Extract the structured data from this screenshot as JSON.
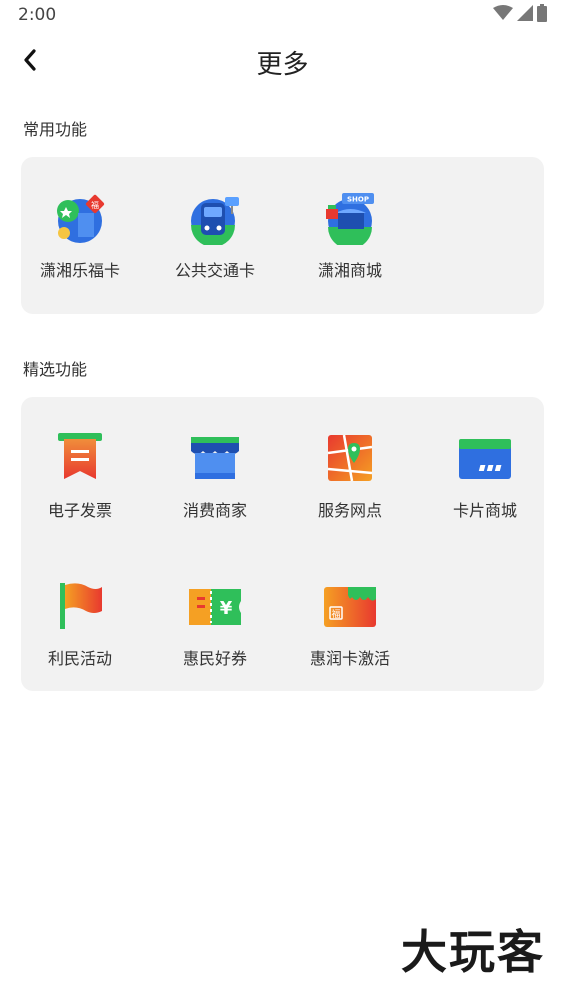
{
  "status_bar": {
    "time": "2:00",
    "icons": [
      "wifi-icon",
      "signal-icon",
      "battery-icon"
    ]
  },
  "header": {
    "title": "更多",
    "back_icon": "back-arrow-icon"
  },
  "common_section": {
    "title": "常用功能",
    "items": [
      {
        "label": "潇湘乐福卡",
        "icon": "lefu-card-icon"
      },
      {
        "label": "公共交通卡",
        "icon": "transit-card-icon"
      },
      {
        "label": "潇湘商城",
        "icon": "shop-icon"
      }
    ]
  },
  "featured_section": {
    "title": "精选功能",
    "items": [
      {
        "label": "电子发票",
        "icon": "invoice-icon"
      },
      {
        "label": "消费商家",
        "icon": "merchant-store-icon"
      },
      {
        "label": "服务网点",
        "icon": "map-location-icon"
      },
      {
        "label": "卡片商城",
        "icon": "card-mall-icon"
      },
      {
        "label": "利民活动",
        "icon": "flag-icon"
      },
      {
        "label": "惠民好券",
        "icon": "coupon-icon"
      },
      {
        "label": "惠润卡激活",
        "icon": "card-activate-icon"
      }
    ]
  },
  "watermark": "大玩客",
  "colors": {
    "card_background": "#f2f2f2",
    "text": "#333333",
    "accent_red": "#e8392f",
    "accent_blue": "#2f6fe0",
    "accent_green": "#2fbf5a"
  }
}
